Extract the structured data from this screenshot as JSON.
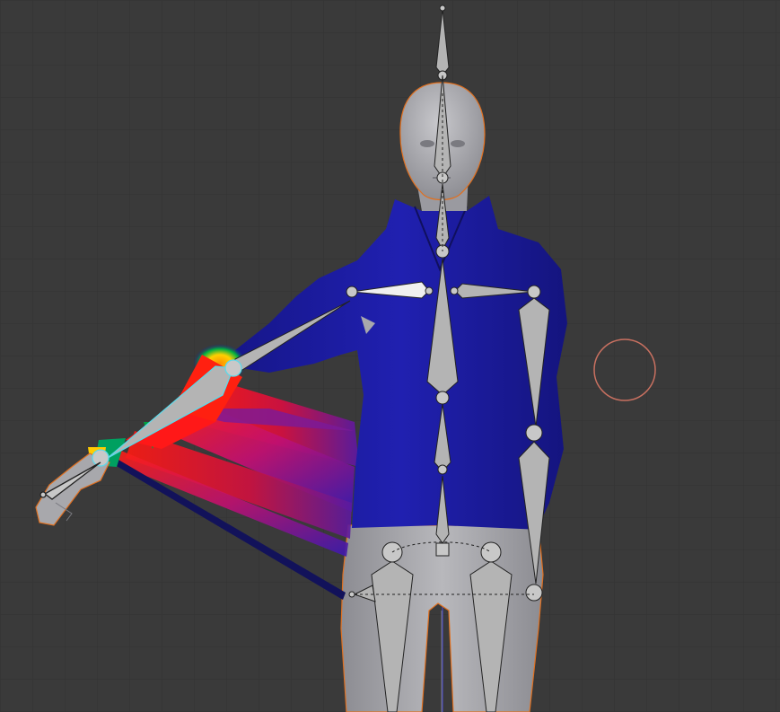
{
  "viewport": {
    "mode": "weight-paint",
    "view": "front-orthographic",
    "grid": true,
    "background_color": "#3a3a3a",
    "grid_color": "#333333"
  },
  "scene": {
    "mesh": "human-figure",
    "jacket_color": "#1a1a9a",
    "body_color": "#a8a8ac",
    "selection_outline_color": "#e07020",
    "active_bone_color": "#5fd8e8",
    "bone_color": "#b4b4b4",
    "weight_gradient": [
      "#1a1a9a",
      "#00a0ff",
      "#00c000",
      "#ffff00",
      "#ff2000"
    ]
  },
  "cursor": {
    "name": "3d-cursor",
    "color": "#c87060"
  }
}
